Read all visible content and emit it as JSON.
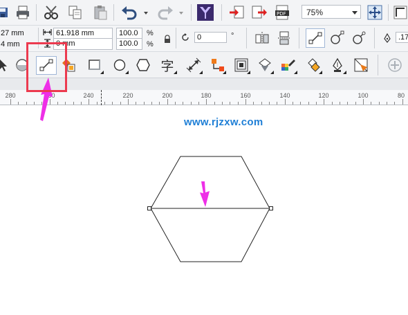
{
  "toolbar": {
    "zoom_level": "75%"
  },
  "property_bar": {
    "x_value": "27 mm",
    "y_value": "4 mm",
    "width_value": "61.918 mm",
    "height_value": "0 mm",
    "scale_x": "100.0",
    "scale_y": "100.0",
    "percent_symbol_1": "%",
    "percent_symbol_2": "%",
    "rotation_value": "0",
    "degree_symbol": "°",
    "outline_value": ".17"
  },
  "toolbox": {
    "text_tool_glyph": "字"
  },
  "ruler": {
    "labels": [
      "280",
      "260",
      "240",
      "220",
      "200",
      "180",
      "160",
      "140",
      "120",
      "100",
      "80"
    ]
  },
  "canvas": {
    "watermark": "www.rjzxw.com"
  },
  "colors": {
    "toolbar_bg": "#f3f4f6",
    "highlight": "#ec3a4f",
    "arrow": "#ee2fe7",
    "watermark": "#1f7fd6",
    "shape_outline": "#222222"
  },
  "icons": [
    "save-icon",
    "print-icon",
    "cut-icon",
    "copy-icon",
    "paste-icon",
    "undo-icon",
    "redo-icon",
    "app-launcher-icon",
    "import-icon",
    "export-icon",
    "pdf-icon",
    "fullscreen-icon",
    "lock-icon",
    "line-tool-icon",
    "freehand-icon",
    "rectangle-icon",
    "ellipse-icon",
    "polygon-icon",
    "text-tool-icon",
    "dimension-icon",
    "connector-icon",
    "contour-icon",
    "fill-icon",
    "eyedropper-icon",
    "pen-outline-icon",
    "add-icon"
  ]
}
